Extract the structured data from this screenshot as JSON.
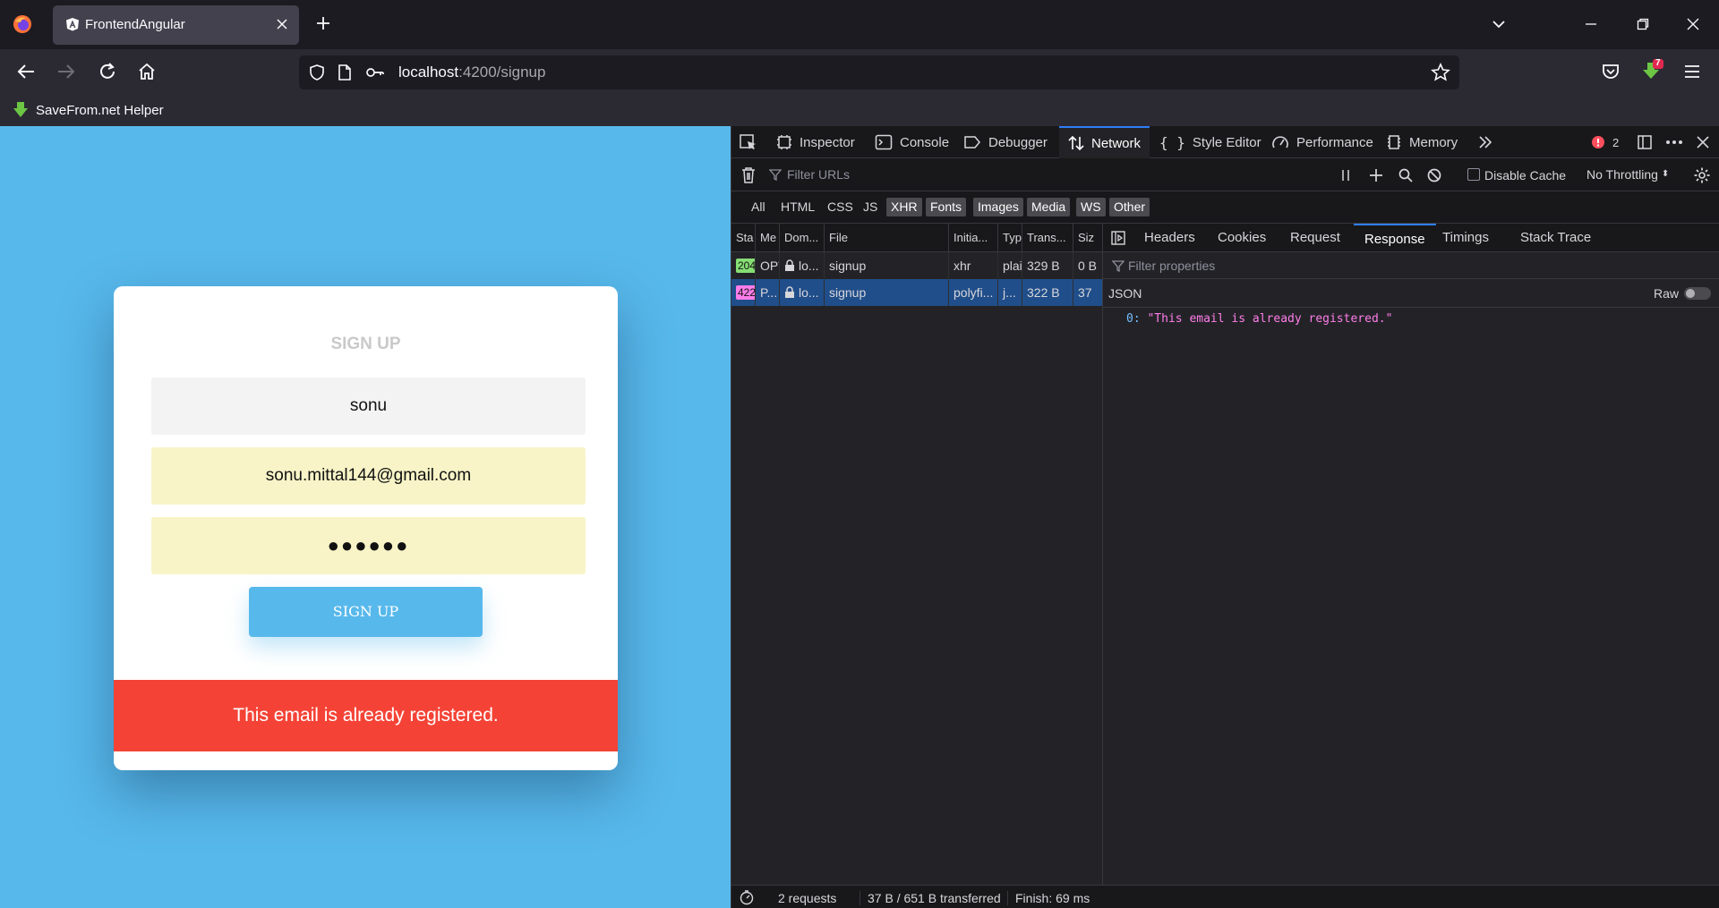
{
  "browser": {
    "tab_title": "FrontendAngular",
    "url_host": "localhost",
    "url_path": ":4200/signup",
    "bookmark": "SaveFrom.net Helper",
    "download_badge": "7"
  },
  "form": {
    "heading": "SIGN UP",
    "name_value": "sonu",
    "email_value": "sonu.mittal144@gmail.com",
    "password_mask": "●●●●●●",
    "submit_label": "SIGN UP",
    "error_message": "This email is already registered."
  },
  "devtools": {
    "tabs": [
      "Inspector",
      "Console",
      "Debugger",
      "Network",
      "Style Editor",
      "Performance",
      "Memory"
    ],
    "active_tab": "Network",
    "error_count": "2",
    "filter_placeholder": "Filter URLs",
    "disable_cache": "Disable Cache",
    "throttling": "No Throttling",
    "type_filters": [
      "All",
      "HTML",
      "CSS",
      "JS",
      "XHR",
      "Fonts",
      "Images",
      "Media",
      "WS",
      "Other"
    ],
    "columns": [
      "Sta",
      "Me",
      "Dom...",
      "File",
      "Initia...",
      "Typ",
      "Trans...",
      "Siz"
    ],
    "requests": [
      {
        "status": "204",
        "method": "OPT",
        "domain": "lo...",
        "file": "signup",
        "initiator": "xhr",
        "type": "plai",
        "transferred": "329 B",
        "size": "0 B",
        "status_color": "#86de74"
      },
      {
        "status": "422",
        "method": "P...",
        "domain": "lo...",
        "file": "signup",
        "initiator": "polyfi...",
        "type": "j...",
        "transferred": "322 B",
        "size": "37",
        "status_color": "#ff7de9"
      }
    ],
    "detail_tabs": [
      "Headers",
      "Cookies",
      "Request",
      "Response",
      "Timings",
      "Stack Trace"
    ],
    "active_detail_tab": "Response",
    "filter_properties": "Filter properties",
    "json_label": "JSON",
    "raw_label": "Raw",
    "response_key": "0:",
    "response_value": "\"This email is already registered.\"",
    "summary": {
      "requests": "2 requests",
      "transferred": "37 B / 651 B transferred",
      "finish": "Finish: 69 ms"
    }
  }
}
